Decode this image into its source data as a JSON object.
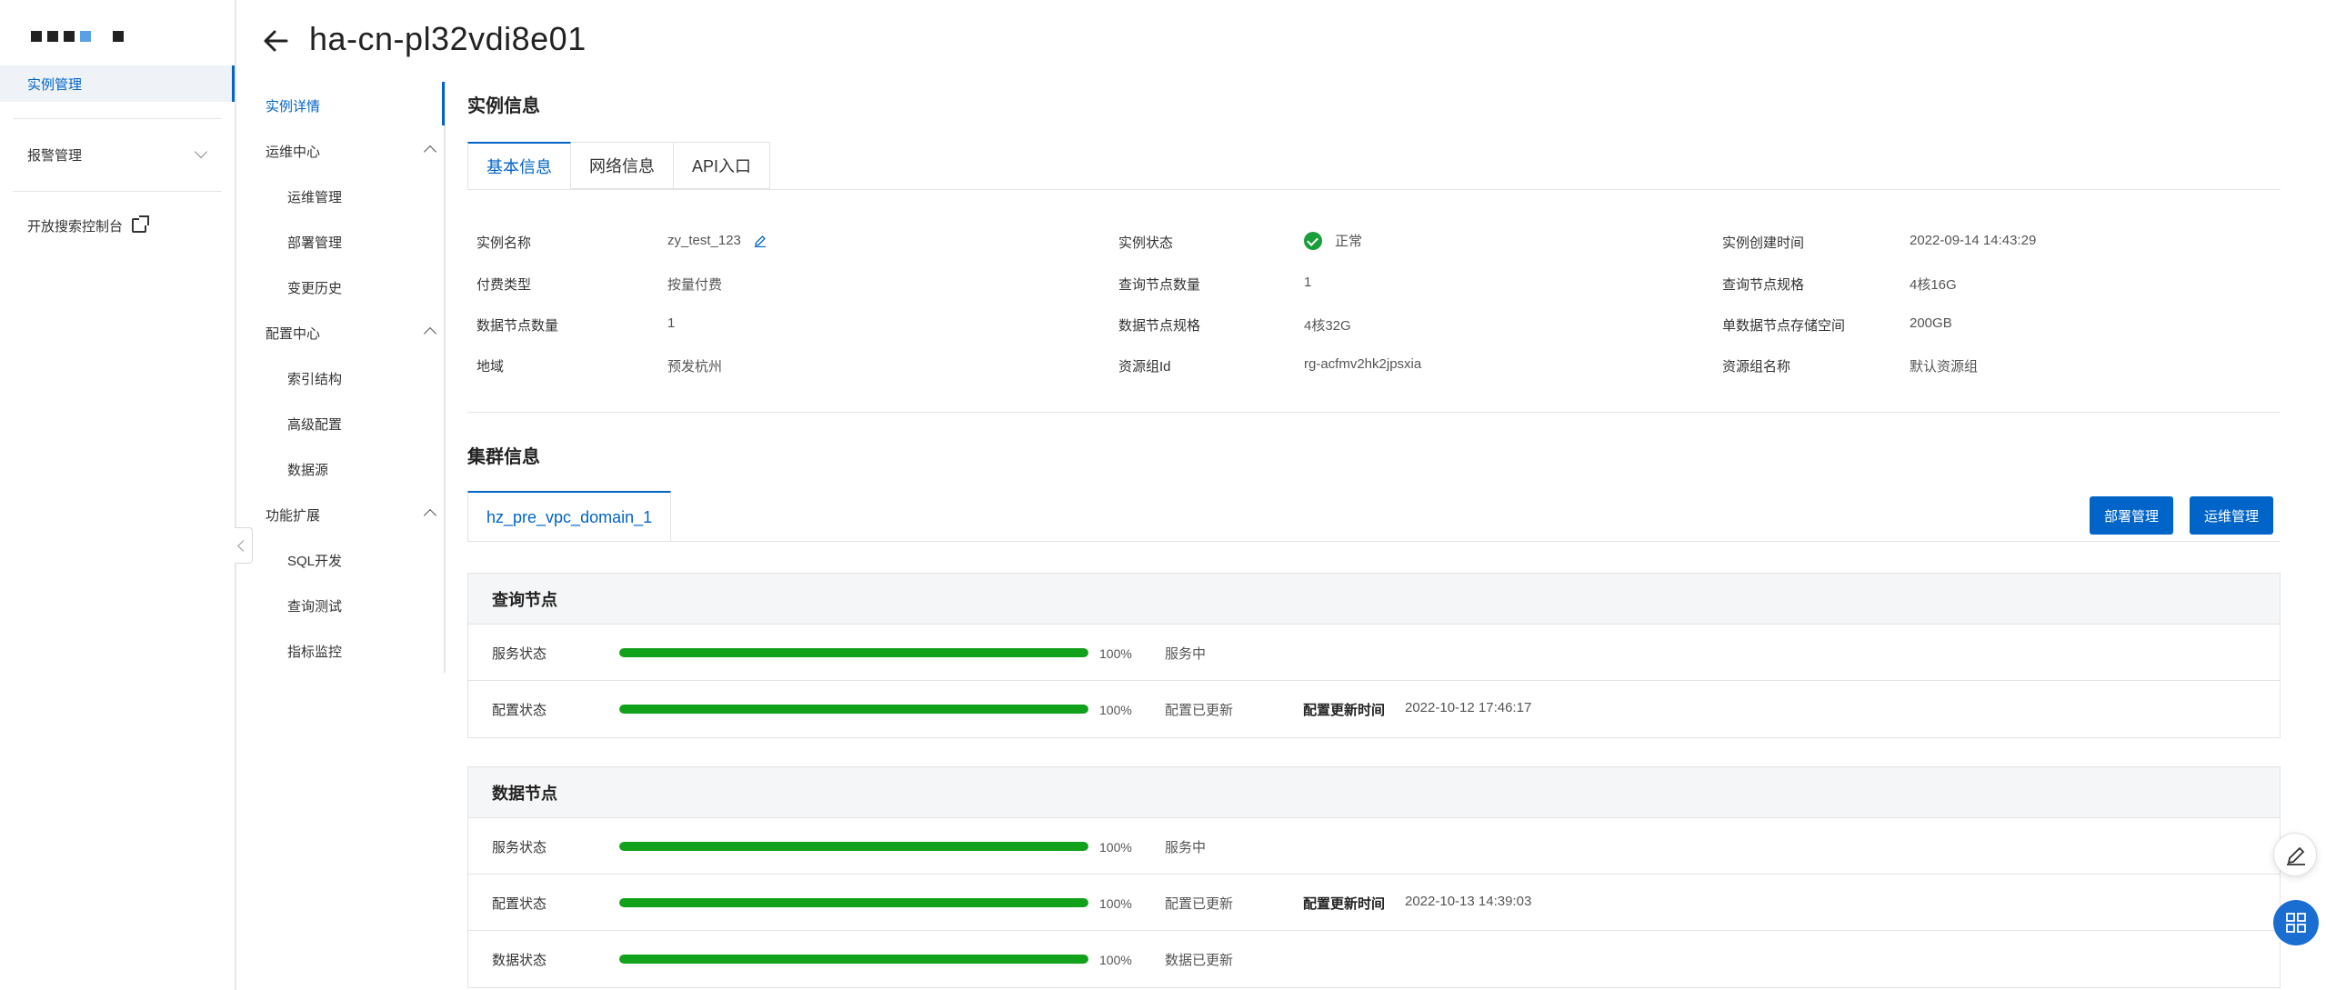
{
  "global_nav": {
    "items": [
      {
        "label": "实例管理",
        "active": true
      },
      {
        "label": "报警管理"
      },
      {
        "label": "开放搜索控制台"
      }
    ]
  },
  "header": {
    "title": "ha-cn-pl32vdi8e01"
  },
  "secondary_nav": {
    "detail": "实例详情",
    "ops_group": "运维中心",
    "ops_items": [
      "运维管理",
      "部署管理",
      "变更历史"
    ],
    "config_group": "配置中心",
    "config_items": [
      "索引结构",
      "高级配置",
      "数据源"
    ],
    "ext_group": "功能扩展",
    "ext_items": [
      "SQL开发",
      "查询测试",
      "指标监控"
    ]
  },
  "instance_info": {
    "title": "实例信息",
    "tabs": [
      "基本信息",
      "网络信息",
      "API入口"
    ],
    "fields": {
      "name_label": "实例名称",
      "name_value": "zy_test_123",
      "status_label": "实例状态",
      "status_value": "正常",
      "created_label": "实例创建时间",
      "created_value": "2022-09-14 14:43:29",
      "billing_label": "付费类型",
      "billing_value": "按量付费",
      "query_count_label": "查询节点数量",
      "query_count_value": "1",
      "query_spec_label": "查询节点规格",
      "query_spec_value": "4核16G",
      "data_count_label": "数据节点数量",
      "data_count_value": "1",
      "data_spec_label": "数据节点规格",
      "data_spec_value": "4核32G",
      "storage_label": "单数据节点存储空间",
      "storage_value": "200GB",
      "region_label": "地域",
      "region_value": "预发杭州",
      "rg_id_label": "资源组Id",
      "rg_id_value": "rg-acfmv2hk2jpsxia",
      "rg_name_label": "资源组名称",
      "rg_name_value": "默认资源组"
    }
  },
  "cluster_info": {
    "title": "集群信息",
    "domain_tab": "hz_pre_vpc_domain_1",
    "deploy_button": "部署管理",
    "ops_button": "运维管理",
    "query_node": {
      "title": "查询节点",
      "rows": [
        {
          "label": "服务状态",
          "progress": 100,
          "pct": "100%",
          "status": "服务中"
        },
        {
          "label": "配置状态",
          "progress": 100,
          "pct": "100%",
          "status": "配置已更新",
          "time_label": "配置更新时间",
          "time_value": "2022-10-12 17:46:17"
        }
      ]
    },
    "data_node": {
      "title": "数据节点",
      "rows": [
        {
          "label": "服务状态",
          "progress": 100,
          "pct": "100%",
          "status": "服务中"
        },
        {
          "label": "配置状态",
          "progress": 100,
          "pct": "100%",
          "status": "配置已更新",
          "time_label": "配置更新时间",
          "time_value": "2022-10-13 14:39:03"
        },
        {
          "label": "数据状态",
          "progress": 100,
          "pct": "100%",
          "status": "数据已更新"
        }
      ]
    }
  },
  "colors": {
    "accent": "#0064c8",
    "success": "#12a11a",
    "status_ok": "#1a9e3a"
  }
}
